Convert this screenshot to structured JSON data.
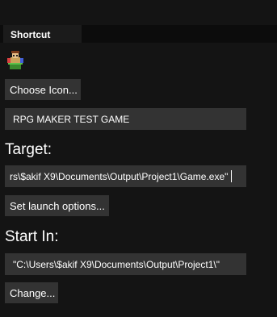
{
  "tabs": [
    {
      "label": "Shortcut"
    }
  ],
  "app_icon": {
    "icon": "rpg-maker-app-icon"
  },
  "buttons": {
    "choose_icon": "Choose Icon...",
    "launch_options": "Set launch options...",
    "change": "Change..."
  },
  "name_field": {
    "value": "RPG MAKER TEST GAME"
  },
  "target": {
    "label": "Target:",
    "value": "rs\\$akif X9\\Documents\\Output\\Project1\\Game.exe\""
  },
  "start_in": {
    "label": "Start In:",
    "value": "\"C:\\Users\\$akif X9\\Documents\\Output\\Project1\\\""
  }
}
